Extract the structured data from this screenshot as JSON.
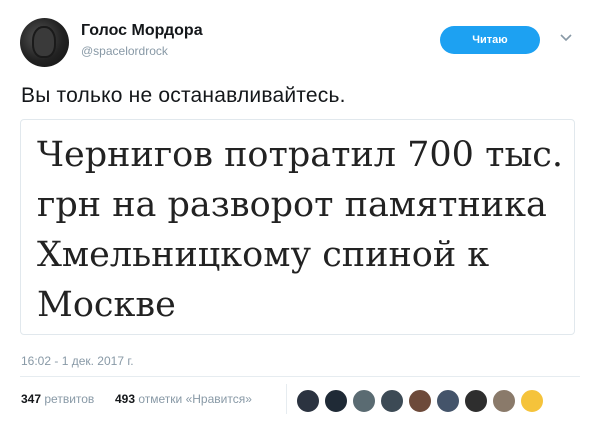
{
  "author": {
    "name": "Голос Мордора",
    "handle": "@spacelordrock"
  },
  "follow_button": {
    "label": "Читаю"
  },
  "caret_icon": "chevron-down-icon",
  "tweet": {
    "text": "Вы только не останавливайтесь.",
    "card_text": "Чернигов потратил 700 тыс. грн на разворот памятника Хмельницкому спиной к Москве",
    "timestamp": "16:02 - 1 дек. 2017 г."
  },
  "stats": {
    "retweets_count": "347",
    "retweets_label": "ретвитов",
    "likes_count": "493",
    "likes_label": "отметки «Нравится»"
  },
  "likers": [
    {
      "color": "#2b3340"
    },
    {
      "color": "#1f2a36"
    },
    {
      "color": "#5a6b72"
    },
    {
      "color": "#3c4a55"
    },
    {
      "color": "#6d4a3a"
    },
    {
      "color": "#44546a"
    },
    {
      "color": "#2e2e2e"
    },
    {
      "color": "#8a7a6a"
    },
    {
      "color": "#f5c33b"
    }
  ],
  "colors": {
    "accent": "#1da1f2",
    "secondary_text": "#8899a6"
  }
}
